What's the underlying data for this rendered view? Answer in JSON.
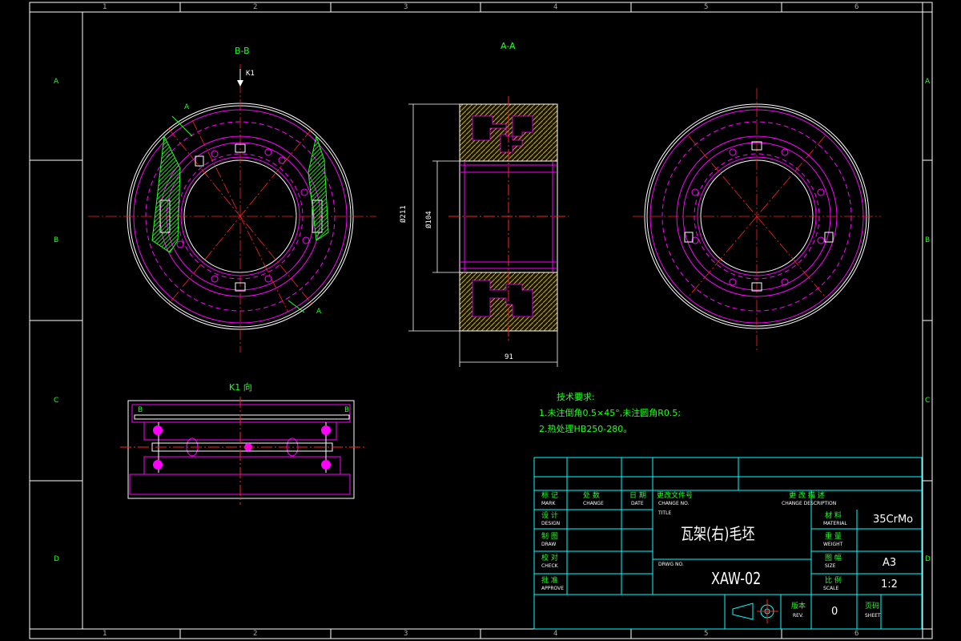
{
  "frame": {
    "columns": [
      "1",
      "2",
      "3",
      "4",
      "5",
      "6"
    ],
    "rows": [
      "A",
      "B",
      "C",
      "D"
    ]
  },
  "views": {
    "section_bb": "B-B",
    "section_aa": "A-A",
    "k1_arrow": "K1",
    "k1_view": "K1 向",
    "cut_a": "A",
    "cut_b": "B"
  },
  "dimensions": {
    "outer_dia": "Ø211",
    "inner_dia": "Ø104",
    "width": "91"
  },
  "tech_notes": {
    "title": "技术要求:",
    "items": [
      "1.未注倒角0.5×45°,未注圆角R0.5;",
      "2.热处理HB250-280。"
    ]
  },
  "title_block": {
    "header_cols": {
      "mark": "标 记",
      "qty": "处 数",
      "date": "日 期",
      "change_doc": "更改文件号",
      "change_desc": "更 改 描 述"
    },
    "header_sub": {
      "mark": "MARK",
      "qty": "CHANGE",
      "date": "DATE",
      "change_doc": "CHANGE NO.",
      "change_desc": "CHANGE DESCRIPTION"
    },
    "left_rows": [
      {
        "cn": "设 计",
        "en": "DESIGN"
      },
      {
        "cn": "制 图",
        "en": "DRAW"
      },
      {
        "cn": "校 对",
        "en": "CHECK"
      },
      {
        "cn": "批 准",
        "en": "APPROVE"
      }
    ],
    "title_label": "TITLE",
    "title": "瓦架(右)毛坯",
    "drawing_no_label": "DRWG NO.",
    "drawing_no": "XAW-02",
    "material_label": {
      "cn": "材 料",
      "en": "MATERIAL"
    },
    "material": "35CrMo",
    "weight_label": {
      "cn": "重 量",
      "en": "WEIGHT"
    },
    "size_label": {
      "cn": "图 幅",
      "en": "SIZE"
    },
    "size": "A3",
    "scale_label": {
      "cn": "比 例",
      "en": "SCALE"
    },
    "scale": "1:2",
    "version_label": {
      "cn": "版本",
      "en": "REV."
    },
    "version": "0",
    "sheet_label": {
      "cn": "页码",
      "en": "SHEET"
    }
  },
  "colors": {
    "background": "#000000",
    "frame": "#ffffff",
    "outline": "#ffffff",
    "hidden": "#ff00ff",
    "center": "#ff2222",
    "annotation": "#22ff22",
    "table": "#00ffff",
    "hatch": "#c8b400"
  }
}
